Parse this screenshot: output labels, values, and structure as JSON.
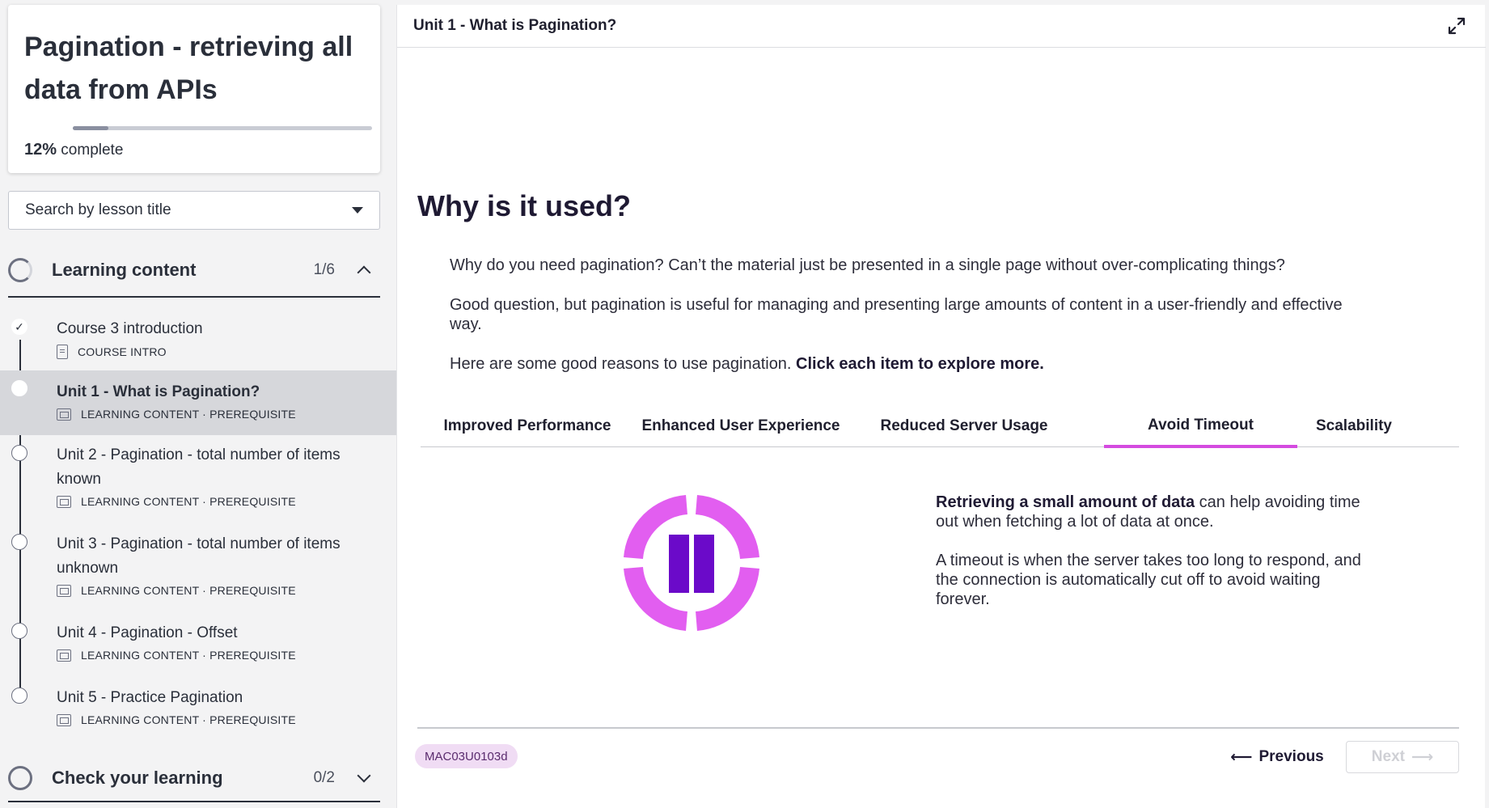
{
  "course": {
    "title": "Pagination - retrieving all data from APIs",
    "progress_value": "12%",
    "progress_label": " complete",
    "progress_fraction": 0.12
  },
  "search": {
    "placeholder": "Search by lesson title"
  },
  "sections": [
    {
      "title": "Learning content",
      "count": "1/6",
      "expanded": true
    },
    {
      "title": "Check your learning",
      "count": "0/2",
      "expanded": false
    }
  ],
  "lessons": [
    {
      "title": "Course 3 introduction",
      "type": "COURSE INTRO",
      "status": "completed",
      "icon": "document-icon"
    },
    {
      "title": "Unit 1 - What is Pagination?",
      "type": "LEARNING CONTENT · PREREQUISITE",
      "status": "current",
      "icon": "slides-icon"
    },
    {
      "title": "Unit 2 - Pagination - total number of items known",
      "type": "LEARNING CONTENT · PREREQUISITE",
      "status": "not-started",
      "icon": "slides-icon"
    },
    {
      "title": "Unit 3 - Pagination - total number of items unknown",
      "type": "LEARNING CONTENT · PREREQUISITE",
      "status": "not-started",
      "icon": "slides-icon"
    },
    {
      "title": "Unit 4 - Pagination - Offset",
      "type": "LEARNING CONTENT · PREREQUISITE",
      "status": "not-started",
      "icon": "slides-icon"
    },
    {
      "title": "Unit 5 - Practice Pagination",
      "type": "LEARNING CONTENT · PREREQUISITE",
      "status": "not-started",
      "icon": "slides-icon"
    }
  ],
  "main": {
    "unit_title": "Unit 1 - What is Pagination?",
    "heading": "Why is it used?",
    "para1": "Why do you need pagination? Can’t the material just be presented in a single page without over-complicating things?",
    "para2": "Good question, but pagination is useful for managing and presenting large amounts of content in a user-friendly and effective way.",
    "para3_plain": "Here are some good reasons to use pagination. ",
    "para3_bold": "Click each item to explore more.",
    "tabs": [
      "Improved Performance",
      "Enhanced User Experience",
      "Reduced Server Usage",
      "Avoid Timeout",
      "Scalability"
    ],
    "active_tab": "Avoid Timeout",
    "panel": {
      "icon": "pause-timeout-icon",
      "p1_bold": "Retrieving a small amount of data",
      "p1_rest": " can help avoiding time out when fetching a lot of data at once.",
      "p2": "A timeout is when the server takes too long to respond, and the connection is automatically cut off to avoid waiting forever."
    },
    "code": "MAC03U0103d",
    "prev_label": "Previous",
    "next_label": "Next"
  },
  "colors": {
    "accent_pink": "#d44be0",
    "icon_purple": "#6b0ac9",
    "icon_pink": "#e25ef0",
    "badge_bg": "#f0dcf4"
  }
}
